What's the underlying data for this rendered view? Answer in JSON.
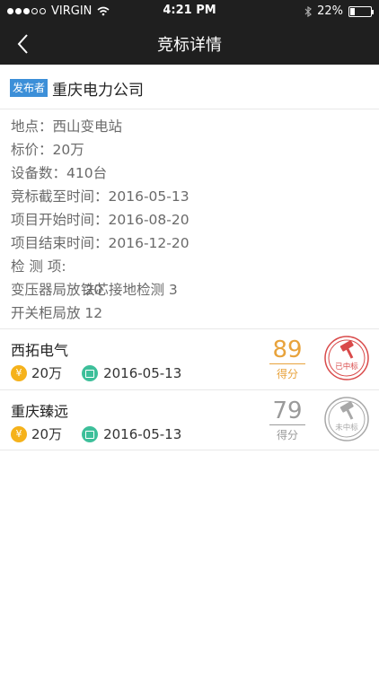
{
  "status": {
    "carrier": "VIRGIN",
    "time": "4:21 PM",
    "battery": "22%",
    "battery_level": 0.22
  },
  "nav": {
    "title": "竞标详情"
  },
  "publisher": {
    "badge": "发布者",
    "name": "重庆电力公司"
  },
  "details": {
    "location": "地点：西山变电站",
    "price": "标价：20万",
    "devices": "设备数：410台",
    "deadline": "竞标截至时间：2016-05-13",
    "start": "项目开始时间：2016-08-20",
    "end": "项目结束时间：2016-12-20",
    "checks_label": "检 测 项:",
    "checks": [
      "铁芯接地检测 3",
      "变压器局放 20",
      "开关柜局放 12"
    ]
  },
  "bids": [
    {
      "name": "西拓电气",
      "price": "20万",
      "date": "2016-05-13",
      "score": "89",
      "score_unit": "得分",
      "stamp": "已中标",
      "won": true,
      "color": "#e8a33c",
      "stamp_color": "#d94a4a"
    },
    {
      "name": "重庆臻远",
      "price": "20万",
      "date": "2016-05-13",
      "score": "79",
      "score_unit": "得分",
      "stamp": "未中标",
      "won": false,
      "color": "#9a9a9a",
      "stamp_color": "#a8a8a8"
    }
  ],
  "icons": {
    "coin": "¥",
    "calendar": "calendar-icon",
    "gavel": "gavel-icon",
    "back": "chevron-left-icon"
  }
}
